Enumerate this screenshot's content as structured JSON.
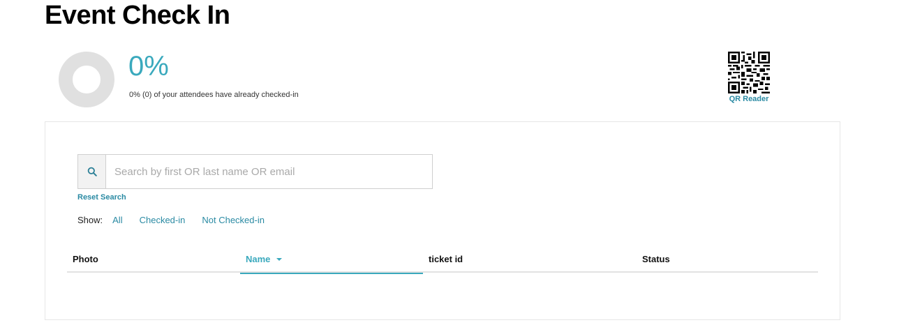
{
  "page": {
    "title": "Event Check In"
  },
  "stats": {
    "percent_text": "0%",
    "checked_in_fraction": 0,
    "summary": "0% (0) of your attendees have already checked-in"
  },
  "qr": {
    "label": "QR Reader",
    "icon": "qr-code-icon"
  },
  "search": {
    "placeholder": "Search by first OR last name OR email",
    "value": "",
    "reset_label": "Reset Search",
    "icon": "search-icon"
  },
  "filters": {
    "label": "Show:",
    "options": [
      "All",
      "Checked-in",
      "Not Checked-in"
    ]
  },
  "table": {
    "columns": [
      "Photo",
      "Name",
      "ticket id",
      "Status"
    ],
    "sorted_column": "Name",
    "rows": []
  },
  "colors": {
    "accent": "#3aa9bd",
    "link": "#2a8aa3",
    "donut_track": "#e0e0e0"
  }
}
